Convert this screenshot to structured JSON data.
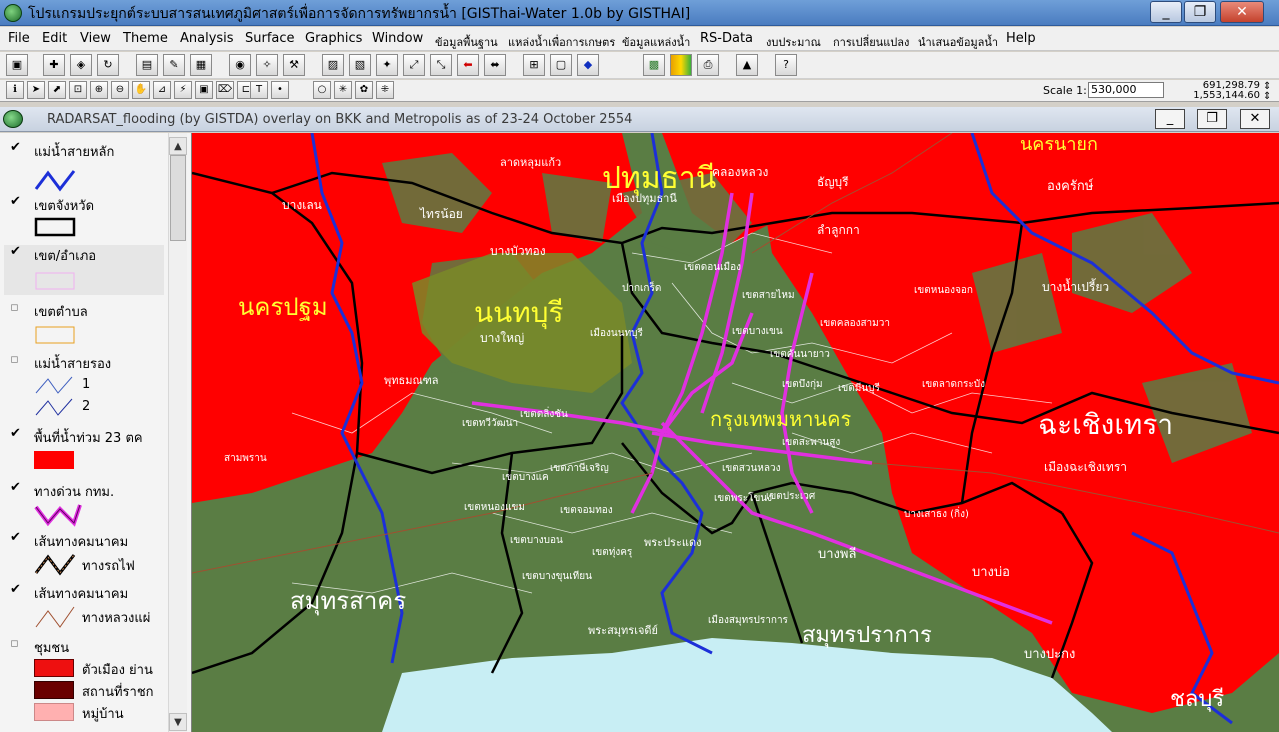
{
  "window": {
    "title": "โปรแกรมประยุกต์ระบบสารสนเทศภูมิศาสตร์เพื่อการจัดการทรัพยากรน้ำ  [GISThai-Water 1.0b   by GISTHAI]",
    "minimize": "_",
    "maximize": "❐",
    "close": "✕"
  },
  "menu": [
    "File",
    "Edit",
    "View",
    "Theme",
    "Analysis",
    "Surface",
    "Graphics",
    "Window",
    "ข้อมูลพื้นฐาน",
    "แหล่งน้ำเพื่อการเกษตร",
    "ข้อมูลแหล่งน้ำ",
    "RS-Data",
    "งบประมาณ",
    "การเปลี่ยนแปลง",
    "นำเสนอข้อมูลน้ำ",
    "Help"
  ],
  "toolbar": {
    "scale_label": "Scale 1:",
    "scale_value": "530,000",
    "coord_x": "691,298.79",
    "coord_y": "1,553,144.60"
  },
  "document": {
    "title": "RADARSAT_flooding (by GISTDA) overlay on BKK and Metropolis as of 23-24 October 2554"
  },
  "legend": [
    {
      "label": "แม่น้ำสายหลัก",
      "checked": true
    },
    {
      "label": "เขตจังหวัด",
      "checked": true
    },
    {
      "label": "เขต/อำเภอ",
      "checked": true
    },
    {
      "label": "เขตตำบล",
      "checked": false
    },
    {
      "label": "แม่น้ำสายรอง",
      "checked": false,
      "sub": [
        "1",
        "2"
      ]
    },
    {
      "label": "พื้นที่น้ำท่วม 23 ตค",
      "checked": true
    },
    {
      "label": "ทางด่วน กทม.",
      "checked": true
    },
    {
      "label": "เส้นทางคมนาคม",
      "checked": true,
      "sub": [
        "ทางรถไฟ"
      ]
    },
    {
      "label": "เส้นทางคมนาคม",
      "checked": true,
      "sub": [
        "ทางหลวงแผ่"
      ]
    },
    {
      "label": "ชุมชน",
      "checked": false,
      "sub": [
        "ตัวเมือง ย่าน",
        "สถานที่ราชก",
        "หมู่บ้าน"
      ]
    }
  ],
  "colors": {
    "flood": "#ff0000",
    "land": "#5a7d44",
    "province_line": "#000000",
    "river": "#1c2fd8",
    "expressway": "#e030e0",
    "sea": "#c8eef4",
    "province_label": "#ffff33",
    "district_label": "#ffffff"
  },
  "map": {
    "provinces": [
      {
        "name": "ปทุมธานี",
        "color": "yellow"
      },
      {
        "name": "นครนายก",
        "color": "yellow"
      },
      {
        "name": "นครปฐม",
        "color": "yellow"
      },
      {
        "name": "นนทบุรี",
        "color": "yellow"
      },
      {
        "name": "กรุงเทพมหานคร",
        "color": "yellow"
      },
      {
        "name": "ฉะเชิงเทรา",
        "color": "white"
      },
      {
        "name": "สมุทรสาคร",
        "color": "white"
      },
      {
        "name": "สมุทรปราการ",
        "color": "white"
      },
      {
        "name": "ชลบุรี",
        "color": "white"
      }
    ],
    "districts": [
      "ลาดหลุมแก้ว",
      "คลองหลวง",
      "ธัญบุรี",
      "องครักษ์",
      "บางเลน",
      "ไทรน้อย",
      "ลำลูกกา",
      "เมืองปทุมธานี",
      "บางบัวทอง",
      "เขตดอนเมือง",
      "ปากเกร็ด",
      "เขตสายไหม",
      "บางน้ำเปรี้ยว",
      "เขตหนองจอก",
      "บางใหญ่",
      "เมืองนนทบุรี",
      "เขตบางเขน",
      "เขตคลองสามวา",
      "เขตมีนบุรี",
      "เขตลาดกระบัง",
      "เขตคันนายาว",
      "เขตทวีวัฒนา",
      "เขตบึงกุ่ม",
      "เขตสะพานสูง",
      "เขตตลิ่งชัน",
      "เขตภาษีเจริญ",
      "เขตบางแค",
      "เขตหนองแขม",
      "เขตจอมทอง",
      "เขตบางบอน",
      "เขตทุ่งครุ",
      "เขตบางขุนเทียน",
      "เขตประเวศ",
      "เขตพระโขนง",
      "เขตสวนหลวง",
      "เมืองฉะเชิงเทรา",
      "บางเสาธง (กิ่ง)",
      "บางพลี",
      "บางบ่อ",
      "พระประแดง",
      "สามพราน",
      "พุทธมณฑล",
      "พระสมุทรเจดีย์",
      "เมืองสมุทรปราการ",
      "บางปะกง"
    ]
  }
}
